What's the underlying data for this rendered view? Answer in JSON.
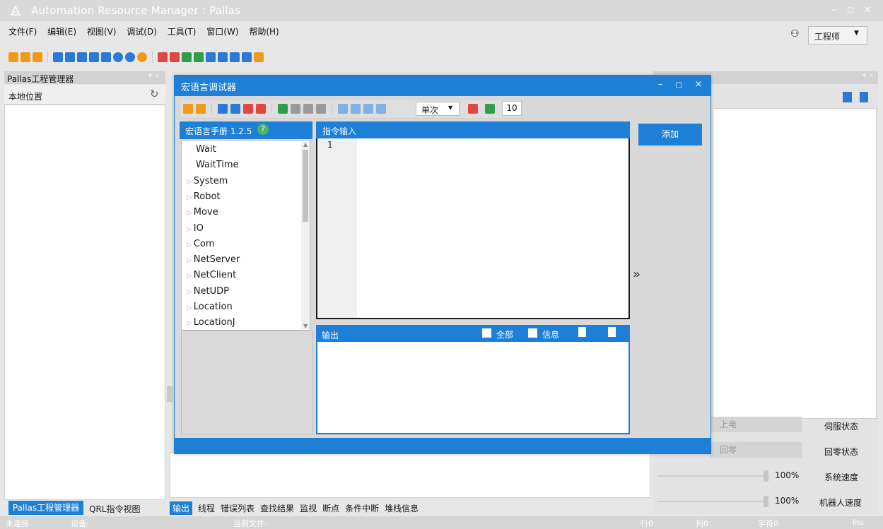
{
  "app": {
    "title": "Automation Resource Manager : Pallas"
  },
  "menu": [
    "文件(F)",
    "编辑(E)",
    "视图(V)",
    "调试(D)",
    "工具(T)",
    "窗口(W)",
    "帮助(H)"
  ],
  "user": {
    "role": "工程师"
  },
  "left_panel": {
    "title": "Pallas工程管理器",
    "location_label": "本地位置",
    "tabs": [
      "Pallas工程管理器",
      "QRL指令视图"
    ]
  },
  "dialog": {
    "title": "宏语言调试器",
    "mode": "单次",
    "count": "10",
    "manual": {
      "title": "宏语言手册 1.2.5",
      "items": [
        {
          "label": "Wait",
          "expandable": false
        },
        {
          "label": "WaitTime",
          "expandable": false
        },
        {
          "label": "System",
          "expandable": true
        },
        {
          "label": "Robot",
          "expandable": true
        },
        {
          "label": "Move",
          "expandable": true
        },
        {
          "label": "IO",
          "expandable": true
        },
        {
          "label": "Com",
          "expandable": true
        },
        {
          "label": "NetServer",
          "expandable": true
        },
        {
          "label": "NetClient",
          "expandable": true
        },
        {
          "label": "NetUDP",
          "expandable": true
        },
        {
          "label": "Location",
          "expandable": true
        },
        {
          "label": "LocationJ",
          "expandable": true
        }
      ]
    },
    "input": {
      "title": "指令输入",
      "line_number": "1"
    },
    "output": {
      "title": "输出",
      "filter_all": "全部",
      "filter_info": "信息"
    },
    "add_button": "添加",
    "expand_glyph": "»"
  },
  "right_panel": {
    "power_button": "上电",
    "servo_status": "伺服状态",
    "home_button": "回零",
    "home_status": "回零状态",
    "system_speed": {
      "label": "系统速度",
      "value": "100%"
    },
    "robot_speed": {
      "label": "机器人速度",
      "value": "100%"
    }
  },
  "bottom_tabs": [
    "输出",
    "线程",
    "错误列表",
    "查找结果",
    "监视",
    "断点",
    "条件中断",
    "堆栈信息"
  ],
  "status": {
    "connection": "未连接",
    "device": "设备:",
    "current_file": "当前文件:",
    "row": "行0",
    "col": "列0",
    "char": "字符0",
    "ins": "Ins"
  },
  "colors": {
    "accent": "#1e7fd6",
    "toolbar_orange": "#f09a1b",
    "toolbar_green": "#2f9d4a",
    "help_green": "#4db36a"
  }
}
